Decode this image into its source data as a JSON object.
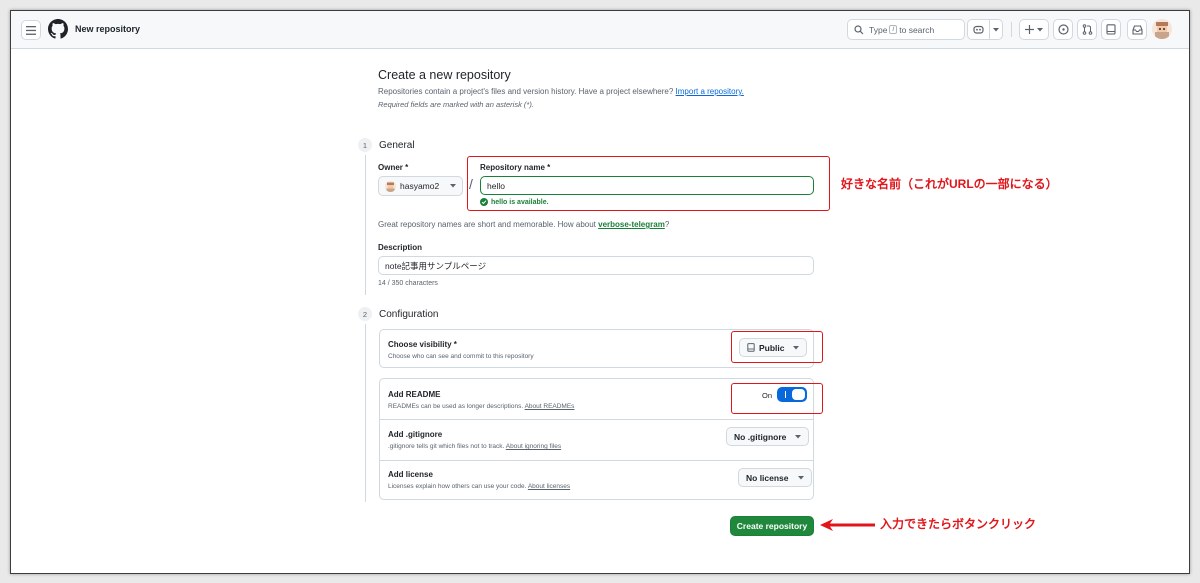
{
  "header": {
    "title": "New repository",
    "search_placeholder_pre": "Type",
    "search_key": "/",
    "search_placeholder_post": "to search"
  },
  "heading": {
    "title": "Create a new repository",
    "subtitle": "Repositories contain a project's files and version history. Have a project elsewhere?",
    "import_link": "Import a repository.",
    "required_note": "Required fields are marked with an asterisk (*)."
  },
  "general": {
    "step": "1",
    "title": "General",
    "owner_label": "Owner *",
    "owner_value": "hasyamo2",
    "slash": "/",
    "repo_label": "Repository name *",
    "repo_value": "hello",
    "availability": "hello is available.",
    "hint_pre": "Great repository names are short and memorable. How about",
    "hint_suggestion": "verbose-telegram",
    "hint_post": "?",
    "description_label": "Description",
    "description_value": "note記事用サンプルページ",
    "char_count": "14 / 350 characters"
  },
  "configuration": {
    "step": "2",
    "title": "Configuration",
    "visibility": {
      "title": "Choose visibility *",
      "desc": "Choose who can see and commit to this repository",
      "value": "Public"
    },
    "readme": {
      "title": "Add README",
      "desc": "READMEs can be used as longer descriptions.",
      "link": "About READMEs",
      "toggle_label": "On"
    },
    "gitignore": {
      "title": "Add .gitignore",
      "desc": ".gitignore tells git which files not to track.",
      "link": "About ignoring files",
      "value": "No .gitignore"
    },
    "license": {
      "title": "Add license",
      "desc": "Licenses explain how others can use your code.",
      "link": "About licenses",
      "value": "No license"
    }
  },
  "create_button": "Create repository",
  "annotations": {
    "name_note": "好きな名前（これがURLの一部になる）",
    "button_note": "入力できたらボタンクリック"
  },
  "colors": {
    "primary_green": "#1f883d",
    "accent_blue": "#0969da",
    "annotation_red": "#e0161b"
  }
}
